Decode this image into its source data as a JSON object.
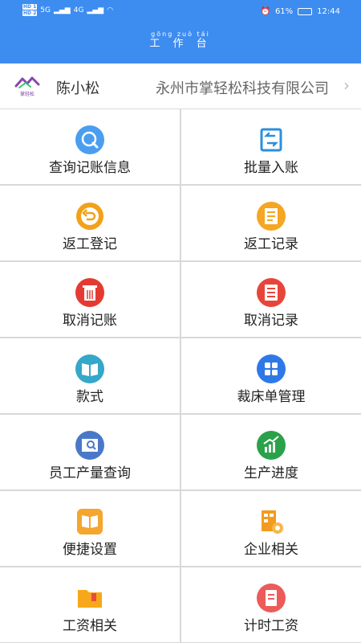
{
  "status_bar": {
    "battery": "61%",
    "time": "12:44",
    "signal_left": "5G",
    "signal_right": "4G"
  },
  "header": {
    "title": "工 作 台",
    "title_pinyin": "gōng zuò tái"
  },
  "company": {
    "logo_text": "掌轻松",
    "user_name": "陈小松",
    "company_name": "永州市掌轻松科技有限公司"
  },
  "menu": [
    {
      "label": "查询记账信息",
      "icon": "search-icon",
      "color": "#4a9ef0"
    },
    {
      "label": "批量入账",
      "icon": "batch-entry-icon",
      "color": "#2c8fdc"
    },
    {
      "label": "返工登记",
      "icon": "undo-icon",
      "color": "#f2a119"
    },
    {
      "label": "返工记录",
      "icon": "record-icon",
      "color": "#f5a623"
    },
    {
      "label": "取消记账",
      "icon": "trash-icon",
      "color": "#e43a32"
    },
    {
      "label": "取消记录",
      "icon": "cancel-record-icon",
      "color": "#e8453a"
    },
    {
      "label": "款式",
      "icon": "book-icon",
      "color": "#35a7c9"
    },
    {
      "label": "裁床单管理",
      "icon": "grid-icon",
      "color": "#2f78e8"
    },
    {
      "label": "员工产量查询",
      "icon": "report-search-icon",
      "color": "#4a78c8"
    },
    {
      "label": "生产进度",
      "icon": "progress-chart-icon",
      "color": "#2aa24a"
    },
    {
      "label": "便捷设置",
      "icon": "settings-book-icon",
      "color": "#f4a62e"
    },
    {
      "label": "企业相关",
      "icon": "enterprise-icon",
      "color": "#f29b1e"
    },
    {
      "label": "工资相关",
      "icon": "folder-icon",
      "color": "#f6a81a"
    },
    {
      "label": "计时工资",
      "icon": "document-icon",
      "color": "#ec5a5a"
    }
  ]
}
